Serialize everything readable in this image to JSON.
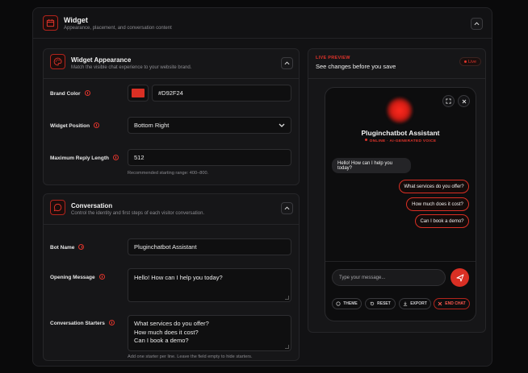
{
  "header": {
    "title": "Widget",
    "subtitle": "Appearance, placement, and conversation content"
  },
  "appearance": {
    "title": "Widget Appearance",
    "subtitle": "Match the visible chat experience to your website brand.",
    "brand_color_label": "Brand Color",
    "brand_color_value": "#D92F24",
    "position_label": "Widget Position",
    "position_value": "Bottom Right",
    "reply_label": "Maximum Reply Length",
    "reply_value": "512",
    "reply_hint": "Recommended starting range: 400–800."
  },
  "conversation": {
    "title": "Conversation",
    "subtitle": "Control the identity and first steps of each visitor conversation.",
    "bot_name_label": "Bot Name",
    "bot_name_value": "Pluginchatbot Assistant",
    "opening_label": "Opening Message",
    "opening_value": "Hello! How can I help you today?",
    "starters_label": "Conversation Starters",
    "starters_value": "What services do you offer?\nHow much does it cost?\nCan I book a demo?",
    "starters_hint": "Add one starter per line. Leave the field empty to hide starters."
  },
  "preview": {
    "eyebrow": "LIVE PREVIEW",
    "title": "See changes before you save",
    "live_badge": "Live",
    "bot_name": "Pluginchatbot Assistant",
    "status": "ONLINE · AI-GENERATED VOICE",
    "greeting": "Hello! How can I help you today?",
    "starters": [
      "What services do you offer?",
      "How much does it cost?",
      "Can I book a demo?"
    ],
    "input_placeholder": "Type your message...",
    "actions": {
      "theme": "THEME",
      "reset": "RESET",
      "export": "EXPORT",
      "end": "END CHAT"
    }
  },
  "colors": {
    "accent": "#D92F24",
    "background": "#0A0A0B",
    "card": "#161618"
  },
  "icons": [
    "calendar-icon",
    "palette-icon",
    "chat-bubble-icon",
    "chevron-up-icon",
    "chevron-down-icon",
    "info-icon",
    "expand-icon",
    "close-icon",
    "send-icon",
    "theme-icon",
    "reset-icon",
    "export-icon",
    "end-chat-icon"
  ]
}
